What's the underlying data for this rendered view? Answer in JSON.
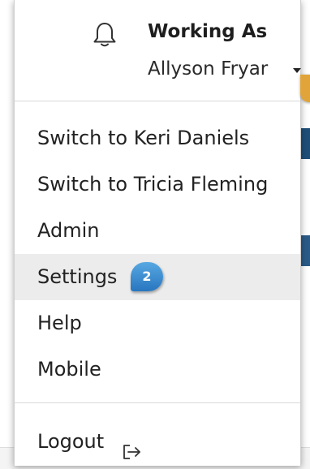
{
  "header": {
    "title": "Working As",
    "user_name": "Allyson Fryar",
    "bell_icon": "bell-icon",
    "caret_icon": "caret-down-icon"
  },
  "menu": {
    "items": [
      {
        "label": "Switch to Keri Daniels"
      },
      {
        "label": "Switch to Tricia Fleming"
      },
      {
        "label": "Admin"
      },
      {
        "label": "Settings"
      },
      {
        "label": "Help"
      },
      {
        "label": "Mobile"
      }
    ],
    "logout_label": "Logout",
    "logout_icon": "logout-icon"
  },
  "annotations": {
    "settings_badge": "2"
  },
  "colors": {
    "highlight_bg": "#ececec",
    "badge_blue": "#2876c0",
    "callout_orange": "#e0a43a"
  }
}
